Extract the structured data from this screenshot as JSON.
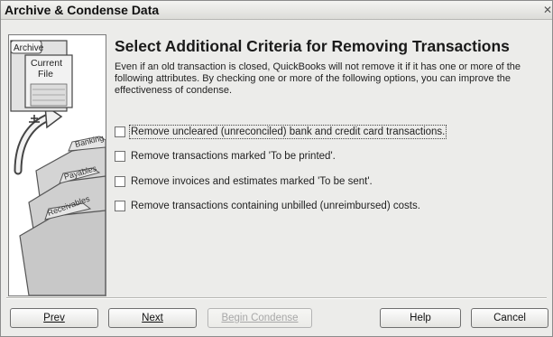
{
  "window": {
    "title": "Archive & Condense Data"
  },
  "illustration": {
    "folders": [
      "Archive",
      "Current",
      "File",
      "Banking",
      "Payables",
      "Receivables"
    ]
  },
  "main": {
    "heading": "Select Additional Criteria for Removing Transactions",
    "description": "Even if an old transaction is closed, QuickBooks will not remove it if it has one or more of the following attributes.  By checking one or more of the following options, you can improve the effectiveness of condense.",
    "options": [
      {
        "label": "Remove uncleared (unreconciled) bank and credit card transactions.",
        "checked": false
      },
      {
        "label": "Remove transactions marked 'To be printed'.",
        "checked": false
      },
      {
        "label": "Remove invoices and estimates marked 'To be sent'.",
        "checked": false
      },
      {
        "label": "Remove transactions containing unbilled (unreimbursed) costs.",
        "checked": false
      }
    ]
  },
  "buttons": {
    "prev": "Prev",
    "next": "Next",
    "begin_condense": "Begin Condense",
    "help": "Help",
    "cancel": "Cancel"
  }
}
